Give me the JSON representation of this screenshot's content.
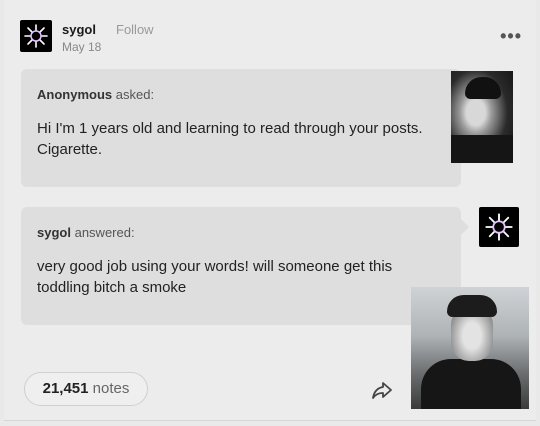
{
  "post": {
    "blog_name": "sygol",
    "follow_label": "Follow",
    "date": "May 18",
    "more_label": "•••"
  },
  "ask": {
    "asker": "Anonymous",
    "asked_suffix": "asked:",
    "question": "Hi I'm 1 years old and learning to read through your posts. Cigarette."
  },
  "answer": {
    "answerer": "sygol",
    "answered_suffix": "answered:",
    "text": "very good job using your words! will someone get this toddling bitch a smoke"
  },
  "footer": {
    "notes_count": "21,451",
    "notes_label": "notes"
  },
  "icons": {
    "avatar": "starburst-avatar-icon",
    "share": "share-arrow-icon"
  }
}
